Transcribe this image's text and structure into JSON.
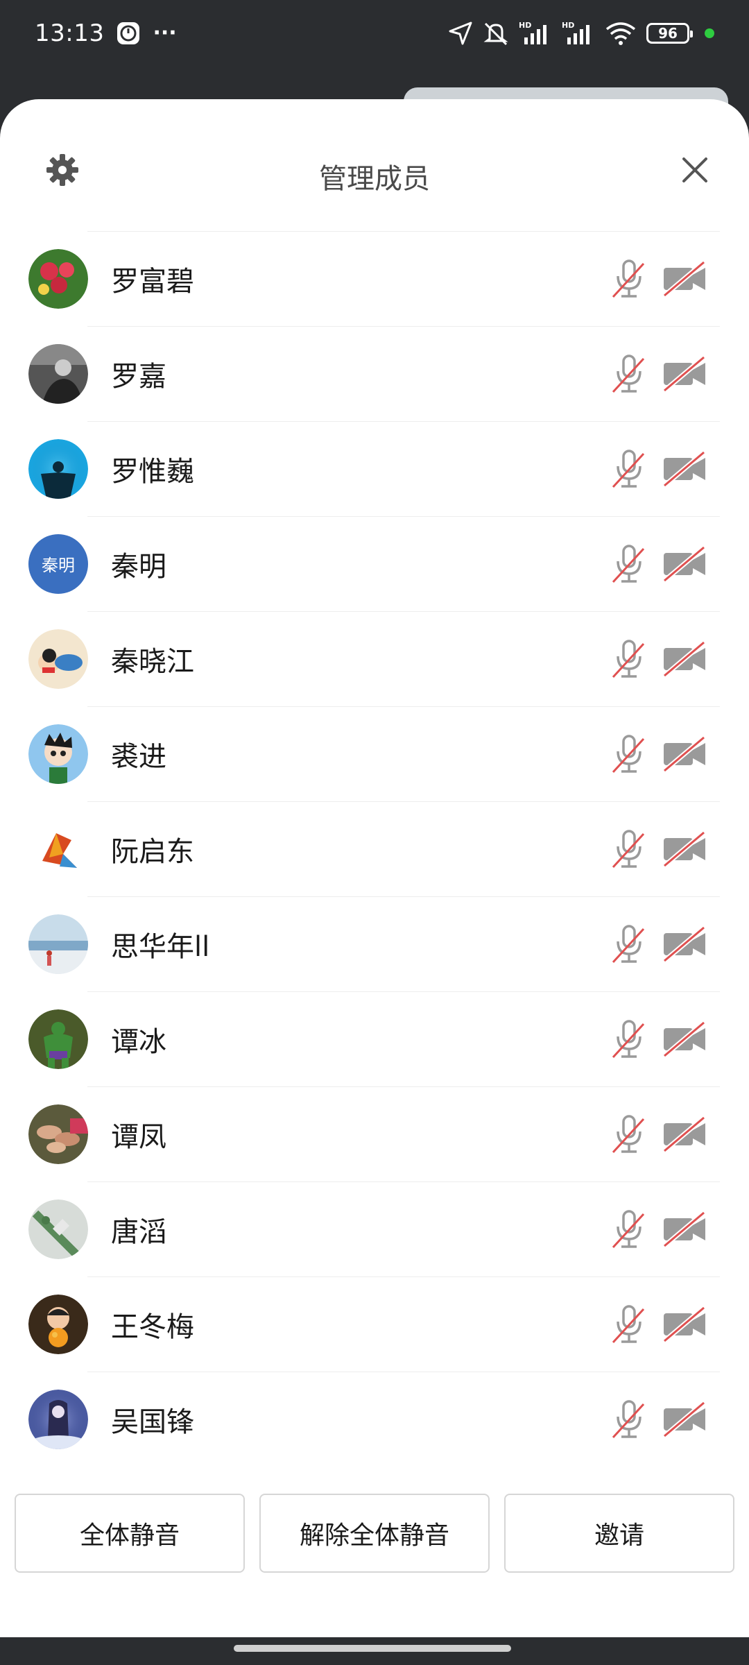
{
  "status_bar": {
    "time": "13:13",
    "more": "···",
    "battery": "96"
  },
  "sheet": {
    "title": "管理成员"
  },
  "members": [
    {
      "name": "罗富碧",
      "avatar": "photo-flowers"
    },
    {
      "name": "罗嘉",
      "avatar": "photo-bw-portrait"
    },
    {
      "name": "罗惟巍",
      "avatar": "photo-underwater"
    },
    {
      "name": "秦明",
      "avatar": "text",
      "avatar_text": "秦明"
    },
    {
      "name": "秦晓江",
      "avatar": "photo-cartoon"
    },
    {
      "name": "裘进",
      "avatar": "photo-astro-boy"
    },
    {
      "name": "阮启东",
      "avatar": "photo-kite"
    },
    {
      "name": "思华年ll",
      "avatar": "photo-beach"
    },
    {
      "name": "谭冰",
      "avatar": "photo-hulk"
    },
    {
      "name": "谭凤",
      "avatar": "photo-hands"
    },
    {
      "name": "唐滔",
      "avatar": "photo-aerial"
    },
    {
      "name": "王冬梅",
      "avatar": "photo-child"
    },
    {
      "name": "吴国锋",
      "avatar": "photo-anime"
    }
  ],
  "actions": {
    "mute_all": "全体静音",
    "unmute_all": "解除全体静音",
    "invite": "邀请"
  },
  "colors": {
    "slash": "#e05050",
    "icon_gray": "#9a9a9a",
    "text_avatar_bg": "#3a6fc0"
  }
}
